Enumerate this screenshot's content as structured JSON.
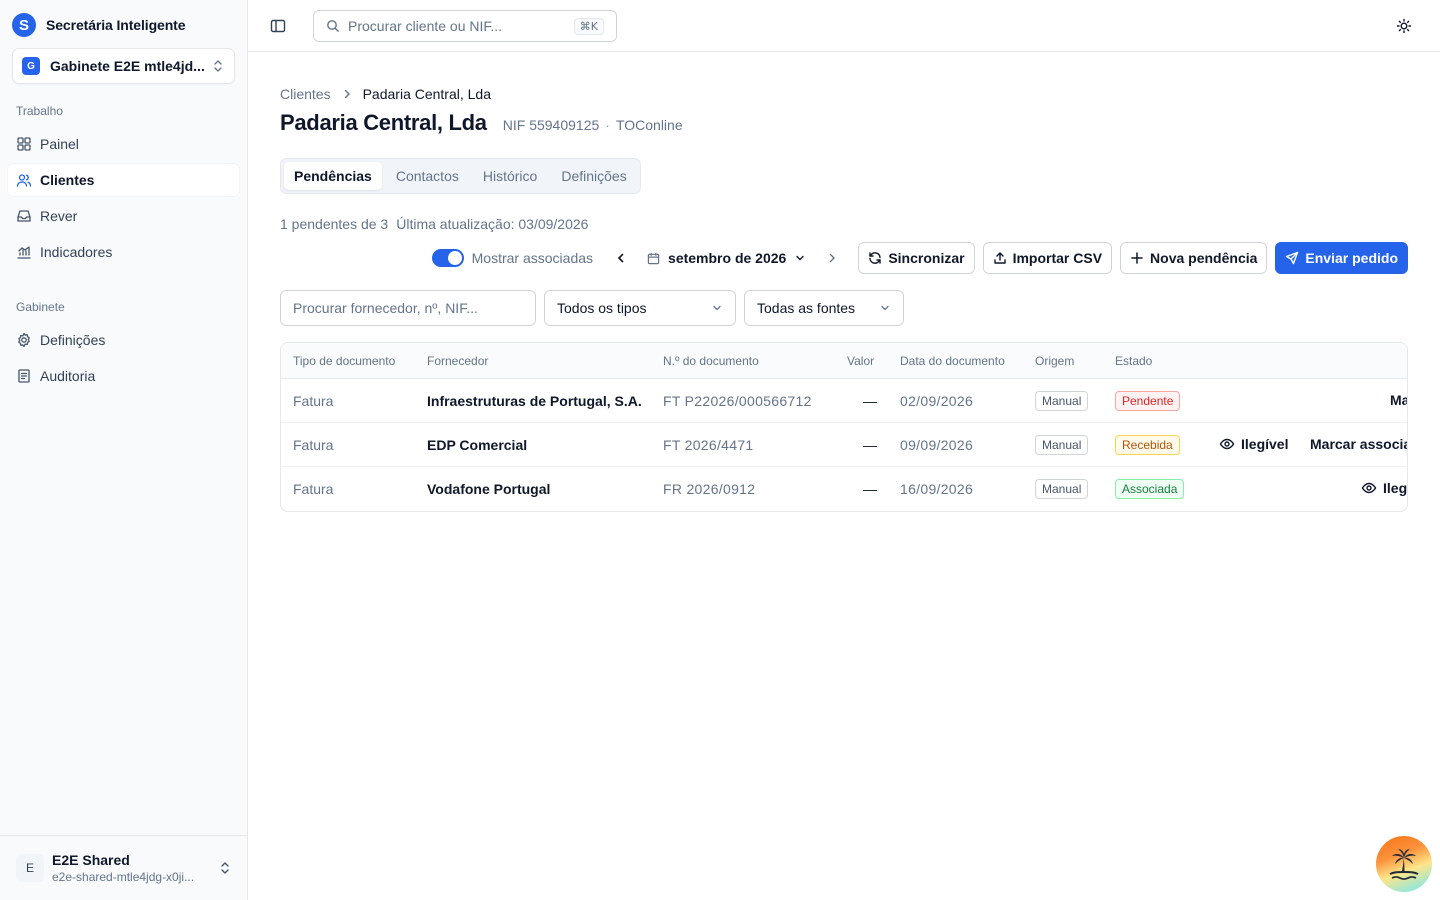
{
  "app": {
    "title": "Secretária Inteligente",
    "logo_letter": "S"
  },
  "workspace": {
    "badge": "G",
    "name": "Gabinete E2E mtle4jd..."
  },
  "sidebar": {
    "section_work": "Trabalho",
    "work_items": [
      {
        "label": "Painel",
        "icon": "grid-icon"
      },
      {
        "label": "Clientes",
        "icon": "users-icon",
        "active": true
      },
      {
        "label": "Rever",
        "icon": "inbox-icon"
      },
      {
        "label": "Indicadores",
        "icon": "chart-icon"
      }
    ],
    "section_office": "Gabinete",
    "office_items": [
      {
        "label": "Definições",
        "icon": "gear-icon"
      },
      {
        "label": "Auditoria",
        "icon": "audit-icon"
      }
    ]
  },
  "user": {
    "initial": "E",
    "name": "E2E Shared",
    "email": "e2e-shared-mtle4jdg-x0ji..."
  },
  "topbar": {
    "search_placeholder": "Procurar cliente ou NIF...",
    "shortcut": "⌘K"
  },
  "breadcrumb": {
    "parent": "Clientes",
    "current": "Padaria Central, Lda"
  },
  "client": {
    "name": "Padaria Central, Lda",
    "nif": "NIF 559409125",
    "separator": "·",
    "source": "TOConline"
  },
  "tabs": [
    "Pendências",
    "Contactos",
    "Histórico",
    "Definições"
  ],
  "status_line": {
    "count": "1 pendentes de 3",
    "updated": "Última atualização: 03/09/2026"
  },
  "toolbar": {
    "toggle_label": "Mostrar associadas",
    "toggle_on": true,
    "month": "setembro de 2026",
    "sync": "Sincronizar",
    "import_csv": "Importar CSV",
    "new_pending": "Nova pendência",
    "send_request": "Enviar pedido"
  },
  "filters": {
    "search_placeholder": "Procurar fornecedor, nº, NIF...",
    "type_select": "Todos os tipos",
    "source_select": "Todas as fontes"
  },
  "table": {
    "headers": [
      "Tipo de documento",
      "Fornecedor",
      "N.º do documento",
      "Valor",
      "Data do documento",
      "Origem",
      "Estado"
    ],
    "rows": [
      {
        "type": "Fatura",
        "supplier": "Infraestruturas de Portugal, S.A.",
        "number": "FT P22026/000566712",
        "value": "—",
        "date": "02/09/2026",
        "origin": "Manual",
        "status": "Pendente",
        "action1": "",
        "action2": "Ma"
      },
      {
        "type": "Fatura",
        "supplier": "EDP Comercial",
        "number": "FT 2026/4471",
        "value": "—",
        "date": "09/09/2026",
        "origin": "Manual",
        "status": "Recebida",
        "action1": "Ilegível",
        "action2": "Marcar associa"
      },
      {
        "type": "Fatura",
        "supplier": "Vodafone Portugal",
        "number": "FR 2026/0912",
        "value": "—",
        "date": "16/09/2026",
        "origin": "Manual",
        "status": "Associada",
        "action1": "Ileg",
        "action2": ""
      }
    ]
  },
  "colors": {
    "accent": "#2563eb",
    "pending_fg": "#dc2626",
    "pending_bg": "#fef2f2",
    "pending_border": "#fca5a5",
    "received_fg": "#b45309",
    "received_bg": "#fffbeb",
    "received_border": "#fcd34d",
    "associated_fg": "#15803d",
    "associated_bg": "#f0fdf4",
    "associated_border": "#86efac"
  }
}
